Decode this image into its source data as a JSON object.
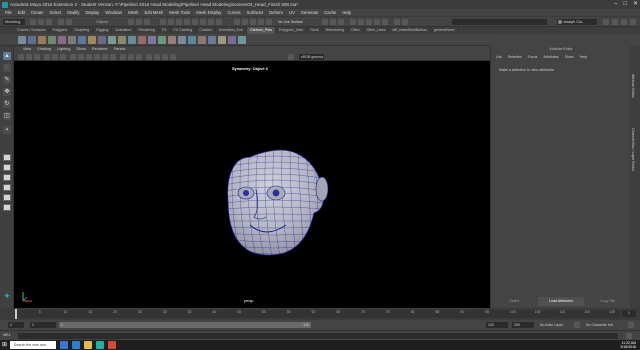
{
  "window": {
    "title": "Autodesk Maya 2016 Extension 2 - Student Version: F:\\Pipeline\\ 2016 Head Modeling\\Pipeline\\ Head Modeling\\scenes\\03_Head_Finish 808.ma*",
    "controls": [
      "–",
      "□",
      "✕"
    ]
  },
  "menubar": {
    "items": [
      "File",
      "Edit",
      "Create",
      "Select",
      "Modify",
      "Display",
      "Windows",
      "Mesh",
      "Edit Mesh",
      "Mesh Tools",
      "Mesh Display",
      "Curves",
      "Surfaces",
      "Deform",
      "UV",
      "Generate",
      "Cache",
      "Help"
    ]
  },
  "statusline": {
    "mode": "Modeling",
    "objects_label": "Objects",
    "live_surface": "No Live Surface",
    "user": "Joseph Clo..."
  },
  "shelf": {
    "tabs": [
      "Curves / Surfaces",
      "Polygons",
      "Sculpting",
      "Rigging",
      "Animation",
      "Rendering",
      "FX",
      "FX Caching",
      "Custom",
      "Animation_Enn",
      "Cartoon_Pots",
      "Polygons_User",
      "Rock",
      "Retexturing",
      "Olbm",
      "Olbm_Uses",
      "diff_makeShellBulbos",
      "generalHeart"
    ],
    "active_tab": "Cartoon_Pots"
  },
  "viewport": {
    "menu": [
      "View",
      "Shading",
      "Lighting",
      "Show",
      "Renderer",
      "Panels"
    ],
    "colorspace": "sRGB gamma",
    "symmetry": "Symmetry: Object X",
    "camera": "persp"
  },
  "attribute_editor": {
    "title": "Attribute Editor",
    "menu": [
      "List",
      "Selected",
      "Focus",
      "Attributes",
      "Show",
      "Help"
    ],
    "message": "Make a selection to view attributes",
    "bottom_tabs": [
      "Select",
      "Load Attributes",
      "Copy Tab"
    ],
    "active_bottom_tab": "Load Attributes",
    "side_tabs": [
      "Attribute Editor",
      "Channel Box / Layer Editor"
    ]
  },
  "timeline": {
    "ticks": [
      "5",
      "10",
      "15",
      "20",
      "25",
      "30",
      "35",
      "40",
      "45",
      "50",
      "55",
      "60",
      "65",
      "70",
      "75",
      "80",
      "85",
      "90",
      "95",
      "100",
      "105",
      "110",
      "115",
      "120"
    ],
    "current_frame": "1"
  },
  "range": {
    "start": "1",
    "start_inner": "1",
    "range_start_label": "1",
    "range_end_label": "120",
    "end_inner": "120",
    "end": "200",
    "anim_layer": "No Anim Layer",
    "character_set": "No Character Set"
  },
  "commandline": {
    "language": "MEL"
  },
  "taskbar": {
    "search_placeholder": "Search the web and Windows",
    "time": "11:22 AM",
    "date": "3/18/2016"
  },
  "colors": {
    "accent": "#1fb0a8",
    "mesh_fill": "#b6b7c6",
    "wire": "#1b1f8a"
  }
}
